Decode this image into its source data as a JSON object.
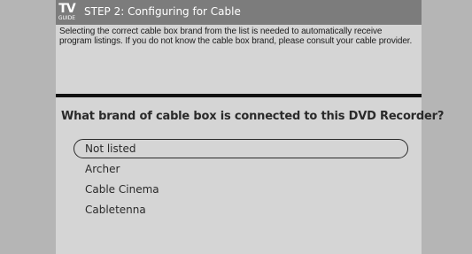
{
  "header": {
    "logo_top": "TV",
    "logo_bottom": "GUIDE",
    "title": "STEP 2: Configuring for Cable"
  },
  "description": "Selecting the correct cable box brand from the list is needed to automatically receive program listings. If you do not know the cable box brand, please consult your cable provider.",
  "question": "What brand of cable box is connected to this DVD Recorder?",
  "brands": [
    {
      "label": "Not listed",
      "selected": true
    },
    {
      "label": "Archer",
      "selected": false
    },
    {
      "label": "Cable Cinema",
      "selected": false
    },
    {
      "label": "Cabletenna",
      "selected": false
    }
  ],
  "colors": {
    "background": "#b5b5b5",
    "panel": "#d5d5d5",
    "titlebar": "#7c7c7c",
    "divider": "#111111",
    "text": "#2a2a2a"
  }
}
